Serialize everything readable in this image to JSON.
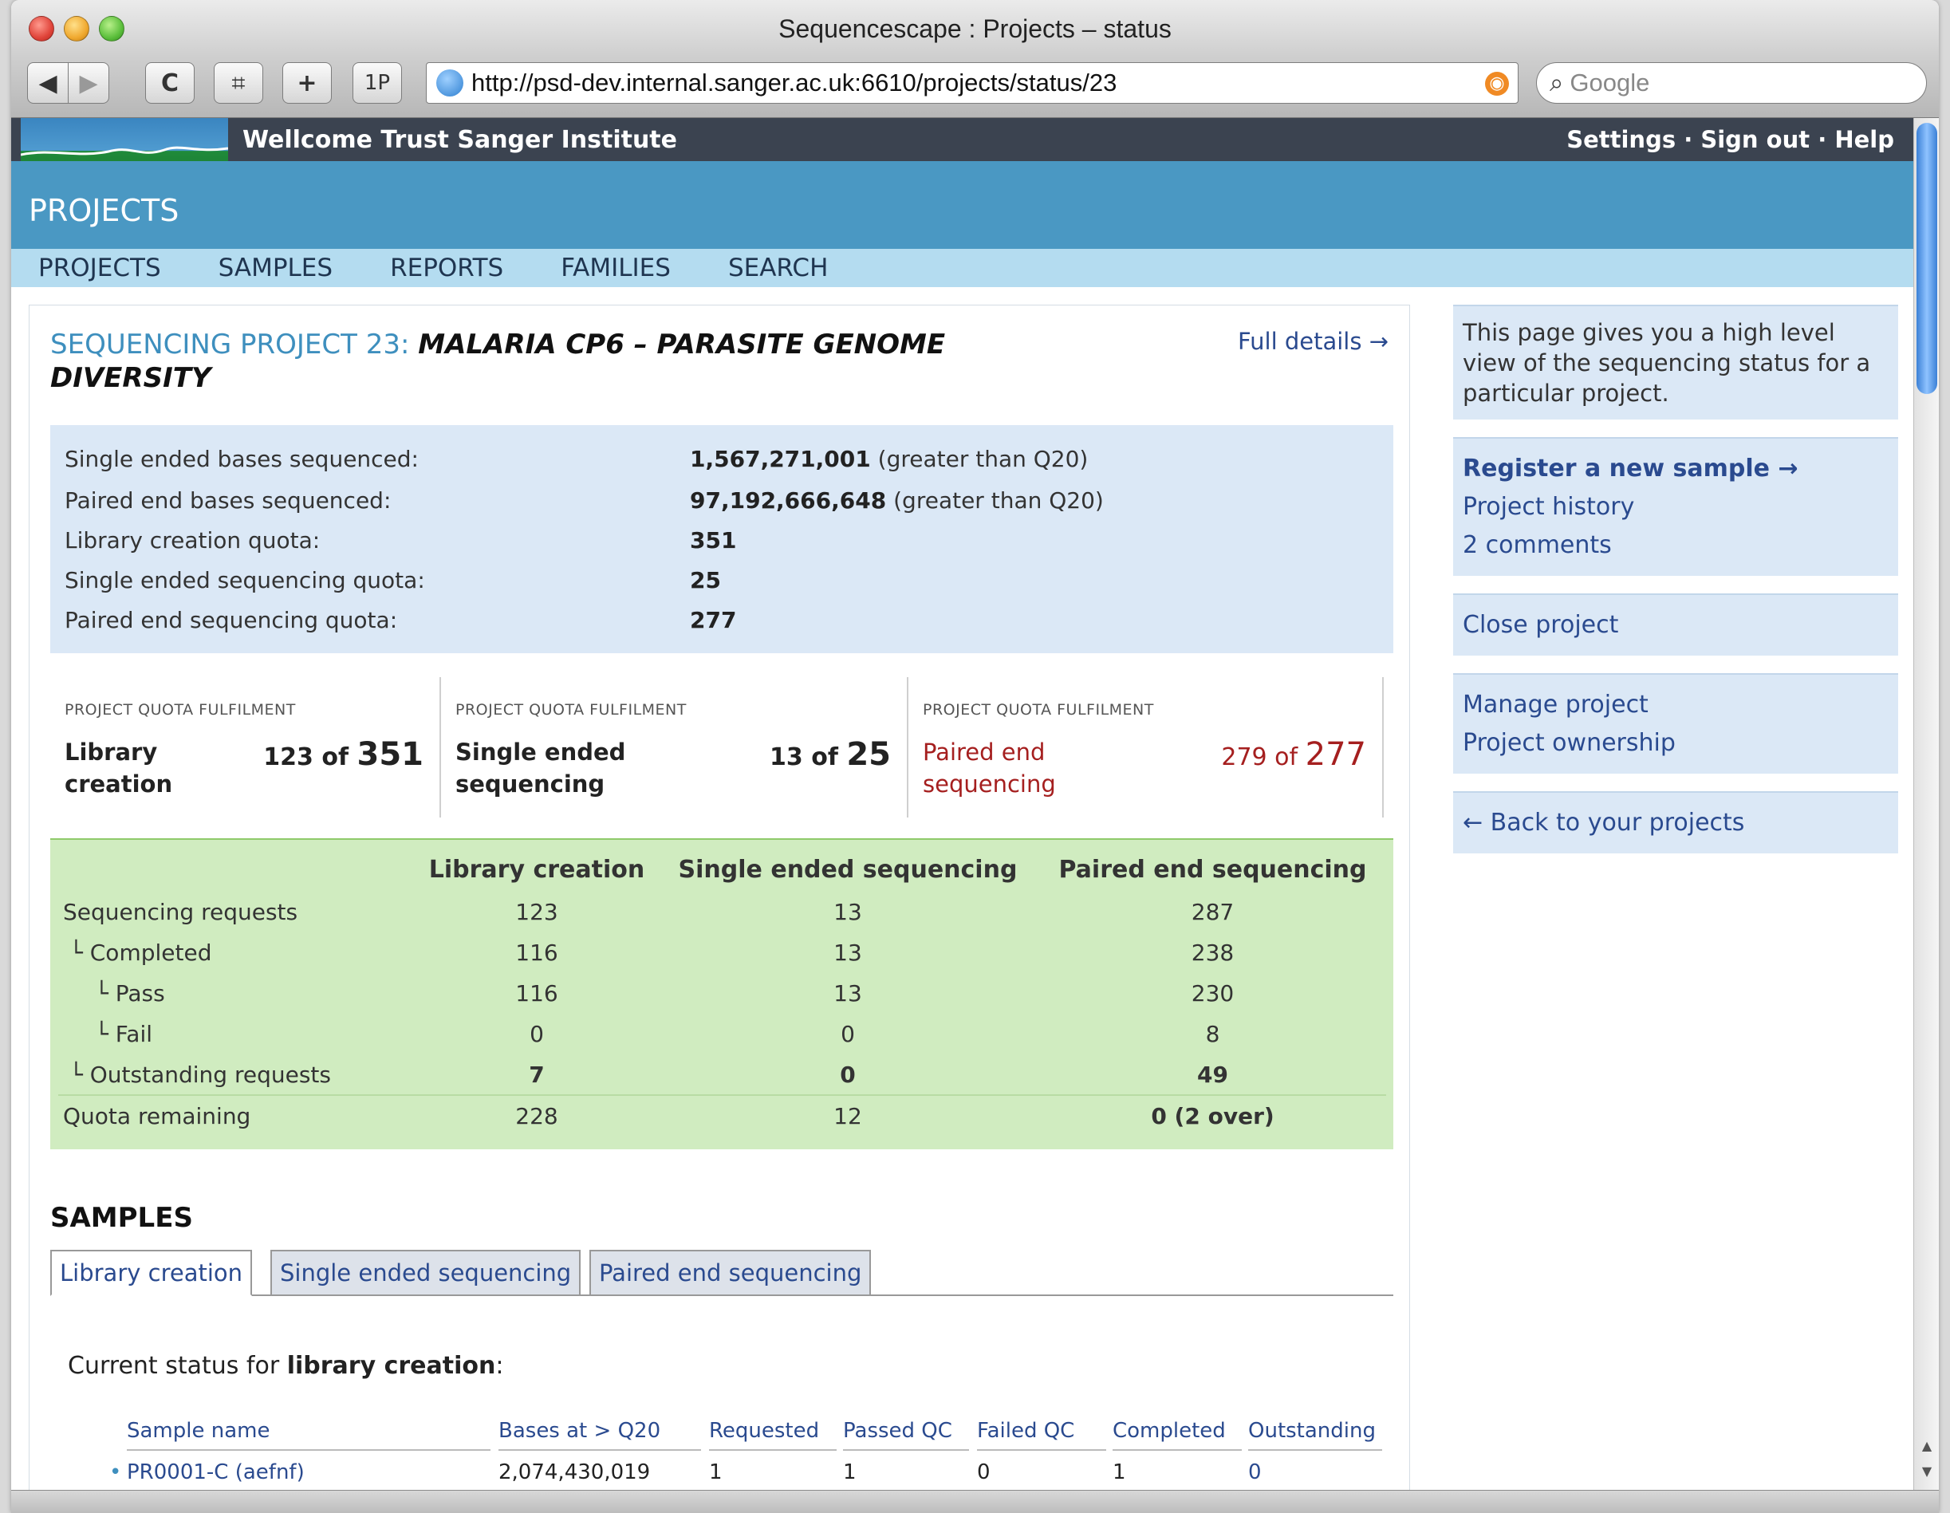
{
  "window": {
    "title": "Sequencescape : Projects – status"
  },
  "browser": {
    "url": "http://psd-dev.internal.sanger.ac.uk:6610/projects/status/23",
    "search_placeholder": "Google",
    "back_label": "◀",
    "forward_label": "▶",
    "reload_label": "C",
    "snap_label": "⌗",
    "add_label": "+",
    "onep_label": "1P"
  },
  "header": {
    "institute": "Wellcome Trust Sanger Institute",
    "settings": "Settings",
    "sign_out": "Sign out",
    "help": "Help",
    "sep": "·",
    "section_title": "PROJECTS"
  },
  "nav": [
    "PROJECTS",
    "SAMPLES",
    "REPORTS",
    "FAMILIES",
    "SEARCH"
  ],
  "project": {
    "prefix": "SEQUENCING PROJECT 23:",
    "name_line1": "MALARIA CP6 – PARASITE GENOME",
    "name_line2": "DIVERSITY",
    "full_details": "Full details →"
  },
  "stats": [
    {
      "label": "Single ended bases sequenced:",
      "value": "1,567,271,001",
      "note": "(greater than Q20)"
    },
    {
      "label": "Paired end bases sequenced:",
      "value": "97,192,666,648",
      "note": "(greater than Q20)"
    },
    {
      "label": "Library creation quota:",
      "value": "351",
      "note": ""
    },
    {
      "label": "Single ended sequencing quota:",
      "value": "25",
      "note": ""
    },
    {
      "label": "Paired end sequencing quota:",
      "value": "277",
      "note": ""
    }
  ],
  "quotas": [
    {
      "heading": "PROJECT QUOTA FULFILMENT",
      "name1": "Library",
      "name2": "creation",
      "done": "123",
      "of": "of",
      "total": "351"
    },
    {
      "heading": "PROJECT QUOTA FULFILMENT",
      "name1": "Single ended",
      "name2": "sequencing",
      "done": "13",
      "of": "of",
      "total": "25"
    },
    {
      "heading": "PROJECT QUOTA FULFILMENT",
      "name1": "Paired end",
      "name2": "sequencing",
      "done": "279",
      "of": "of",
      "total": "277"
    }
  ],
  "summary": {
    "headers": [
      "",
      "Library creation",
      "Single ended sequencing",
      "Paired end sequencing"
    ],
    "rows": [
      [
        "Sequencing requests",
        "123",
        "13",
        "287"
      ],
      [
        "└ Completed",
        "116",
        "13",
        "238"
      ],
      [
        "└ Pass",
        "116",
        "13",
        "230"
      ],
      [
        "└ Fail",
        "0",
        "0",
        "8"
      ],
      [
        "└ Outstanding requests",
        "7",
        "0",
        "49"
      ],
      [
        "Quota remaining",
        "228",
        "12",
        "0 (2 over)"
      ]
    ]
  },
  "samples": {
    "heading": "SAMPLES",
    "tabs": [
      "Library creation",
      "Single ended sequencing",
      "Paired end sequencing"
    ],
    "current_prefix": "Current status for ",
    "current_bold": "library creation",
    "current_suffix": ":",
    "columns": [
      "Sample name",
      "Bases at > Q20",
      "Requested",
      "Passed QC",
      "Failed QC",
      "Completed",
      "Outstanding"
    ],
    "rows": [
      [
        "PR0001-C (aefnf)",
        "2,074,430,019",
        "1",
        "1",
        "0",
        "1",
        "0"
      ]
    ]
  },
  "sidebar": {
    "info": "This page gives you a high level view of the sequencing status for a particular project.",
    "register": "Register a new sample →",
    "history": "Project history",
    "comments": "2 comments",
    "close": "Close project",
    "manage": "Manage project",
    "ownership": "Project ownership",
    "back": "← Back to your projects"
  },
  "colors": {
    "accent_blue": "#4a98c3",
    "summary_green": "#d0ecc0",
    "over_quota_red": "#a51f1f"
  }
}
